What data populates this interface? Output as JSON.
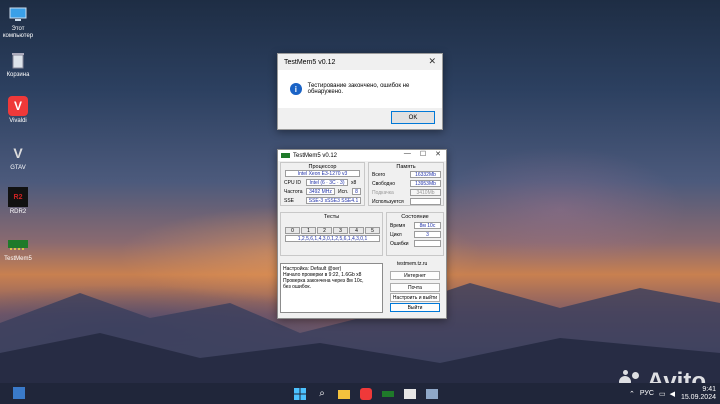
{
  "desktop": {
    "icons": [
      {
        "label": "Этот компьютер",
        "icon": "computer-icon"
      },
      {
        "label": "Корзина",
        "icon": "recycle-bin-icon"
      },
      {
        "label": "Vivaldi",
        "icon": "vivaldi-icon"
      },
      {
        "label": "GTAV",
        "icon": "gtav-icon"
      },
      {
        "label": "RDR2",
        "icon": "rdr2-icon"
      },
      {
        "label": "TestMem5",
        "icon": "testmem-icon"
      }
    ],
    "watermark": "Avito"
  },
  "dialog": {
    "title": "TestMem5 v0.12",
    "message": "Тестирование закончено, ошибок не обнаружено.",
    "ok_label": "OK"
  },
  "app": {
    "title": "TestMem5 v0.12",
    "processor": {
      "header": "Процессор",
      "name": "Intel Xeon  E3-1270 v3",
      "cpuid_label": "CPU ID",
      "cpuid_value": "Intel  (6 · 3C · 3)",
      "cpuid_extra": "x8",
      "freq_label": "Частота",
      "freq_value": "3492 MHz",
      "used_label": "Исп.",
      "used_value": "8",
      "sse_label": "SSE",
      "sse_value": "SSE-3 sSSE3 SSE4.1"
    },
    "memory": {
      "header": "Память",
      "total_label": "Всего",
      "total_value": "16332Mb",
      "free_label": "Свободно",
      "free_value": "13953Mb",
      "paging_label": "Подкачка",
      "paging_value": "3410Mb",
      "used_label": "Используется",
      "used_value": ""
    },
    "tests": {
      "header": "Тесты",
      "tabs": [
        "0",
        "1",
        "2",
        "3",
        "4",
        "5"
      ],
      "sequence": "1,2,5,6,1,4,3,0,1,2,5,6,1,4,3,0,1"
    },
    "state": {
      "header": "Состояние",
      "time_label": "Время",
      "time_value": "8м 10с",
      "cycle_label": "Цикл",
      "cycle_value": "3",
      "errors_label": "Ошибки",
      "errors_value": ""
    },
    "site": "testmem.tz.ru",
    "log": [
      "Настройка: Default @ser)",
      "Начало проверки в 9:22, 1.6Gb x8",
      "Проверка закончена через 8м 10с,",
      "без ошибок."
    ],
    "buttons": {
      "internet": "Интернет",
      "mail": "Почта",
      "settings_exit": "Настроить и выйти",
      "exit": "Выйти"
    }
  },
  "taskbar": {
    "lang": "РУС",
    "time": "9:41",
    "date": "15.09.2024"
  },
  "colors": {
    "accent": "#0078d7",
    "taskbar": "#20263a",
    "value_text": "#2233aa"
  }
}
